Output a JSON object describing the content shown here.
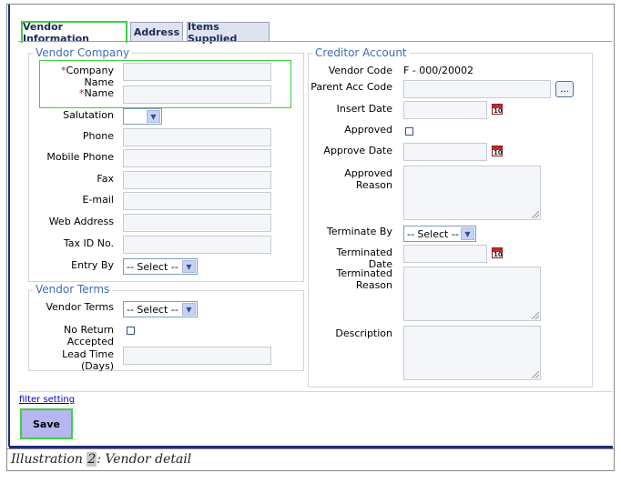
{
  "tabs": [
    {
      "label": "Vendor Information",
      "active": true
    },
    {
      "label": "Address",
      "active": false
    },
    {
      "label": "Items Supplied",
      "active": false
    }
  ],
  "vendor_company": {
    "legend": "Vendor Company",
    "company_name_label": "Company Name",
    "name_label": "Name",
    "salutation_label": "Salutation",
    "phone_label": "Phone",
    "mobile_phone_label": "Mobile Phone",
    "fax_label": "Fax",
    "email_label": "E-mail",
    "web_address_label": "Web Address",
    "tax_id_label": "Tax ID No.",
    "entry_by_label": "Entry By",
    "entry_by_value": "-- Select --",
    "salutation_value": "",
    "required_marker": "*"
  },
  "vendor_terms": {
    "legend": "Vendor Terms",
    "vendor_terms_label": "Vendor Terms",
    "vendor_terms_value": "-- Select --",
    "no_return_label_1": "No Return",
    "no_return_label_2": "Accepted",
    "lead_time_label": "Lead Time (Days)"
  },
  "creditor_account": {
    "legend": "Creditor Account",
    "vendor_code_label": "Vendor Code",
    "vendor_code_value": "F - 000/20002",
    "parent_acc_code_label": "Parent Acc Code",
    "browse_label": "...",
    "insert_date_label": "Insert Date",
    "approved_label": "Approved",
    "approve_date_label": "Approve Date",
    "approved_reason_label": "Approved Reason",
    "terminate_by_label": "Terminate By",
    "terminate_by_value": "-- Select --",
    "terminated_date_label": "Terminated Date",
    "terminated_reason_label_1": "Terminated",
    "terminated_reason_label_2": "Reason",
    "description_label": "Description",
    "calendar_glyph": "10"
  },
  "footer": {
    "filter_link": "filter setting",
    "save_label": "Save"
  },
  "caption": {
    "prefix": "Illustration ",
    "number": "2",
    "suffix": ": Vendor detail"
  }
}
